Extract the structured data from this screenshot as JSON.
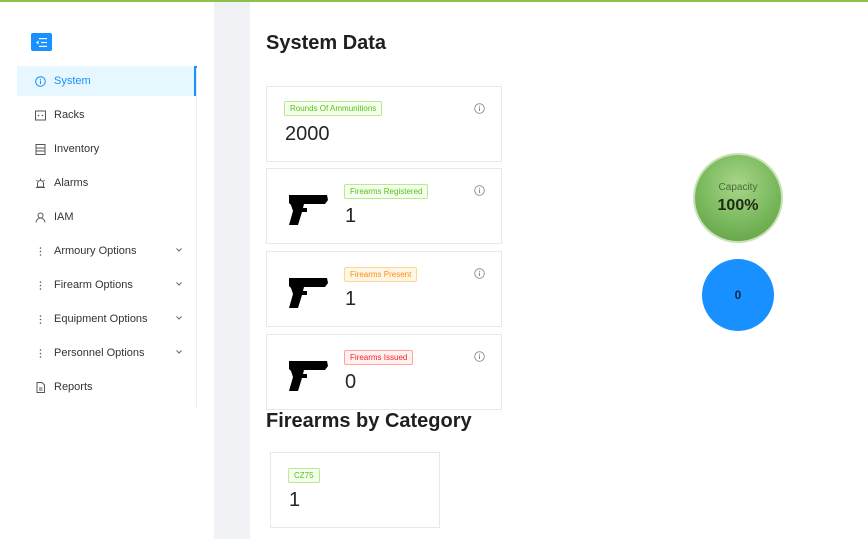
{
  "sidebar": {
    "items": [
      {
        "label": "System",
        "icon": "info-circle-icon",
        "active": true
      },
      {
        "label": "Racks",
        "icon": "rack-icon"
      },
      {
        "label": "Inventory",
        "icon": "list-icon"
      },
      {
        "label": "Alarms",
        "icon": "alarm-icon"
      },
      {
        "label": "IAM",
        "icon": "user-icon"
      },
      {
        "label": "Armoury Options",
        "icon": "more-vertical-icon",
        "expandable": true
      },
      {
        "label": "Firearm Options",
        "icon": "more-vertical-icon",
        "expandable": true
      },
      {
        "label": "Equipment Options",
        "icon": "more-vertical-icon",
        "expandable": true
      },
      {
        "label": "Personnel Options",
        "icon": "more-vertical-icon",
        "expandable": true
      },
      {
        "label": "Reports",
        "icon": "file-icon"
      }
    ]
  },
  "main": {
    "title": "System Data",
    "cards": [
      {
        "tag": "Rounds Of Ammunitions",
        "tag_color": "#52c41a",
        "value": "2000"
      },
      {
        "tag": "Firearms Registered",
        "tag_color": "#52c41a",
        "value": "1",
        "icon": "pistol-icon"
      },
      {
        "tag": "Firearms Present",
        "tag_color": "#fa8c16",
        "value": "1",
        "icon": "pistol-icon"
      },
      {
        "tag": "Firearms Issued",
        "tag_color": "#f5222d",
        "value": "0",
        "icon": "pistol-icon"
      }
    ],
    "capacity": {
      "label": "Capacity",
      "value": "100%",
      "fraction": 1.0
    },
    "blue_circle": {
      "value": "0"
    },
    "category_title": "Firearms by Category",
    "categories": [
      {
        "tag": "CZ75",
        "value": "1"
      }
    ]
  },
  "colors": {
    "accent": "#1890ff",
    "top_bar": "#8fbf4a",
    "capacity_green": "#79b85c"
  }
}
